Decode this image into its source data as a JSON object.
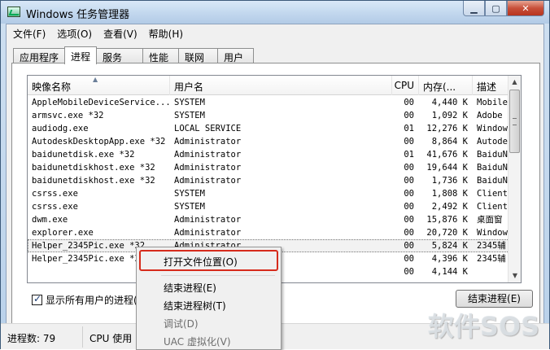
{
  "window": {
    "title": "Windows 任务管理器"
  },
  "menu": [
    "文件(F)",
    "选项(O)",
    "查看(V)",
    "帮助(H)"
  ],
  "tabs": [
    "应用程序",
    "进程",
    "服务",
    "性能",
    "联网",
    "用户"
  ],
  "columns": [
    "映像名称",
    "用户名",
    "CPU",
    "内存(...",
    "描述"
  ],
  "processes": [
    [
      "AppleMobileDeviceService...",
      "SYSTEM",
      "00",
      "4,440 K",
      "MobileD"
    ],
    [
      "armsvc.exe *32",
      "SYSTEM",
      "00",
      "1,092 K",
      "Adobe A"
    ],
    [
      "audiodg.exe",
      "LOCAL SERVICE",
      "01",
      "12,276 K",
      "Windows"
    ],
    [
      "AutodeskDesktopApp.exe *32",
      "Administrator",
      "00",
      "8,864 K",
      "Autodes"
    ],
    [
      "baidunetdisk.exe *32",
      "Administrator",
      "01",
      "41,676 K",
      "BaiduNe"
    ],
    [
      "baidunetdiskhost.exe *32",
      "Administrator",
      "00",
      "19,644 K",
      "BaiduNe"
    ],
    [
      "baidunetdiskhost.exe *32",
      "Administrator",
      "00",
      "1,736 K",
      "BaiduNe"
    ],
    [
      "csrss.exe",
      "SYSTEM",
      "00",
      "1,808 K",
      "Client"
    ],
    [
      "csrss.exe",
      "SYSTEM",
      "00",
      "2,492 K",
      "Client"
    ],
    [
      "dwm.exe",
      "Administrator",
      "00",
      "15,876 K",
      "桌面窗"
    ],
    [
      "explorer.exe",
      "Administrator",
      "00",
      "20,720 K",
      "Windows"
    ],
    [
      "Helper_2345Pic.exe *32",
      "Administrator",
      "00",
      "5,824 K",
      "2345辅"
    ],
    [
      "Helper_2345Pic.exe *3",
      "",
      "00",
      "4,396 K",
      "2345辅"
    ],
    [
      "",
      "",
      "00",
      "4,144 K",
      ""
    ]
  ],
  "show_all_label": "显示所有用户的进程(S)",
  "end_process_button": "结束进程(E)",
  "status": {
    "process_count": "进程数: 79",
    "cpu_usage": "CPU 使用"
  },
  "context_menu": {
    "items": [
      {
        "label": "打开文件位置(O)",
        "disabled": false
      },
      {
        "label": "结束进程(E)",
        "disabled": false
      },
      {
        "label": "结束进程树(T)",
        "disabled": false
      },
      {
        "label": "调试(D)",
        "disabled": true
      },
      {
        "label": "UAC 虚拟化(V)",
        "disabled": true
      }
    ]
  },
  "watermark": "软件SOS"
}
